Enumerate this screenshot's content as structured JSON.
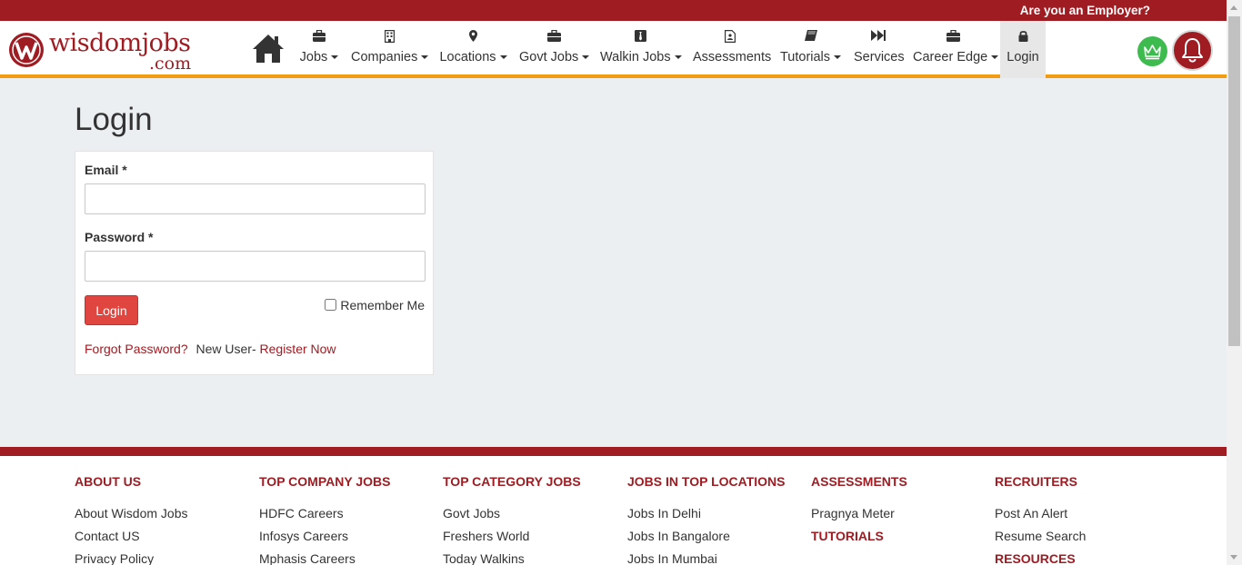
{
  "topbar": {
    "employer_link": "Are you an Employer?"
  },
  "brand": {
    "name": "wisdomjobs",
    "suffix": ".com",
    "color": "#9e1c22"
  },
  "nav": {
    "home_icon": "home-icon",
    "items": [
      {
        "label": "Jobs",
        "icon": "briefcase-icon",
        "dropdown": true
      },
      {
        "label": "Companies",
        "icon": "building-icon",
        "dropdown": true
      },
      {
        "label": "Locations",
        "icon": "map-marker-icon",
        "dropdown": true
      },
      {
        "label": "Govt Jobs",
        "icon": "briefcase-icon",
        "dropdown": true
      },
      {
        "label": "Walkin Jobs",
        "icon": "tie-icon",
        "dropdown": true
      },
      {
        "label": "Assessments",
        "icon": "clipboard-icon",
        "dropdown": false
      },
      {
        "label": "Tutorials",
        "icon": "book-icon",
        "dropdown": true
      },
      {
        "label": "Services",
        "icon": "fast-forward-icon",
        "dropdown": false
      },
      {
        "label": "Career Edge",
        "icon": "briefcase-icon",
        "dropdown": true
      },
      {
        "label": "Login",
        "icon": "lock-icon",
        "dropdown": false
      }
    ]
  },
  "login": {
    "title": "Login",
    "email_label": "Email *",
    "email_value": "",
    "password_label": "Password *",
    "password_value": "",
    "submit_label": "Login",
    "remember_label": "Remember Me",
    "forgot_label": "Forgot Password?",
    "new_user_text": "New User-",
    "register_label": "Register Now"
  },
  "footer": {
    "about": {
      "heading": "ABOUT US",
      "links": [
        "About Wisdom Jobs",
        "Contact US",
        "Privacy Policy"
      ]
    },
    "company": {
      "heading": "TOP COMPANY JOBS",
      "links": [
        "HDFC Careers",
        "Infosys Careers",
        "Mphasis Careers"
      ]
    },
    "category": {
      "heading": "TOP CATEGORY JOBS",
      "links": [
        "Govt Jobs",
        "Freshers World",
        "Today Walkins"
      ]
    },
    "locations": {
      "heading": "JOBS IN TOP LOCATIONS",
      "links": [
        "Jobs In Delhi",
        "Jobs In Bangalore",
        "Jobs In Mumbai"
      ]
    },
    "assessments": {
      "heading": "ASSESSMENTS",
      "links": [
        "Pragnya Meter"
      ],
      "heading2": "TUTORIALS"
    },
    "recruiters": {
      "heading": "RECRUITERS",
      "links": [
        "Post An Alert",
        "Resume Search"
      ],
      "heading2": "RESOURCES"
    }
  },
  "colors": {
    "topbar": "#9e1c22",
    "accent": "#f39c12",
    "button": "#e0463f",
    "crown_bg": "#3dbb4f"
  }
}
